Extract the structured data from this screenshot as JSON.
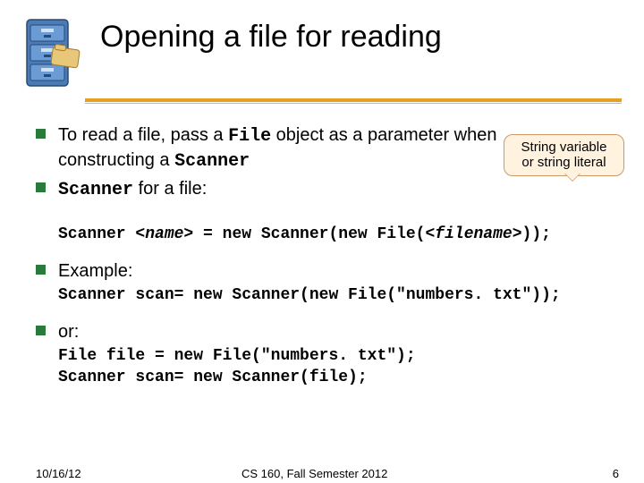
{
  "title": "Opening a file for reading",
  "bullets": {
    "b1": "To read a file, pass a ",
    "b1_code1": "File",
    "b1_mid": " object as a parameter when constructing a ",
    "b1_code2": "Scanner",
    "b2_code": "Scanner",
    "b2_rest": " for a file:",
    "example_label": "Example:",
    "or_label": "or:"
  },
  "callout": {
    "line1": "String variable",
    "line2": "or string literal"
  },
  "code": {
    "syntax_pre": "Scanner ",
    "syntax_name": "<name>",
    "syntax_mid": " = new Scanner(new File(",
    "syntax_fname": "<filename>",
    "syntax_post": "));",
    "example1": "Scanner scan= new Scanner(new File(\"numbers. txt\"));",
    "or1": "File file = new File(\"numbers. txt\");",
    "or2": "Scanner scan= new Scanner(file);"
  },
  "footer": {
    "date": "10/16/12",
    "course": "CS 160, Fall Semester 2012",
    "pagenum": "6"
  },
  "icon_name": "file-cabinet-icon"
}
